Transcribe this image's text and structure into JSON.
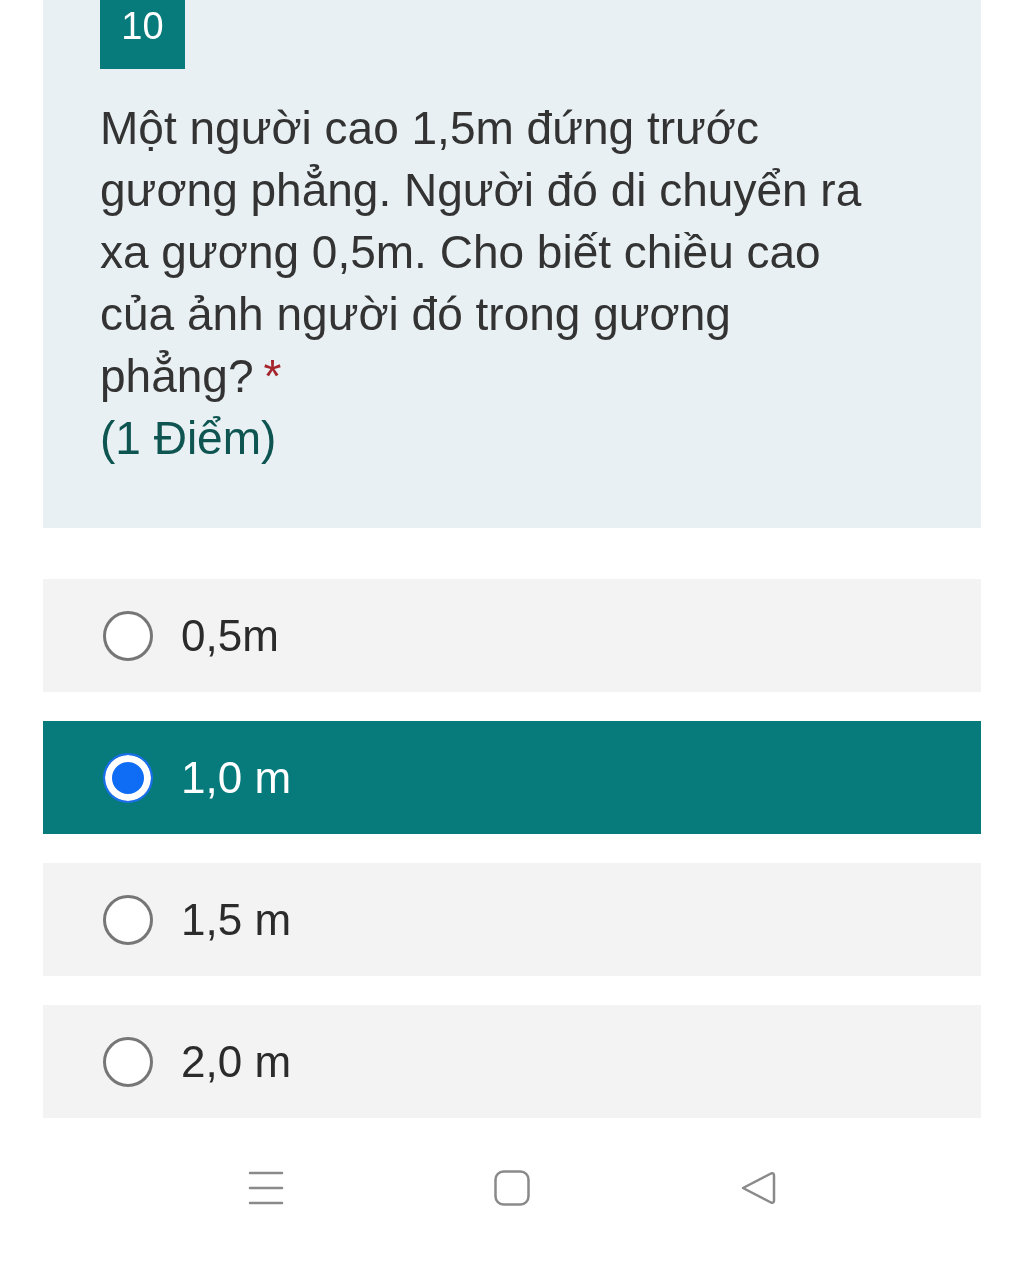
{
  "question": {
    "number": "10",
    "text": "Một người cao 1,5m đứng trước gương phẳng. Người đó di chuyển ra xa gương 0,5m. Cho biết chiều cao của ảnh người đó trong gương phẳng?",
    "required_mark": "*",
    "points": "(1 Điểm)"
  },
  "options": [
    {
      "label": "0,5m",
      "selected": false
    },
    {
      "label": "1,0 m",
      "selected": true
    },
    {
      "label": "1,5 m",
      "selected": false
    },
    {
      "label": "2,0 m",
      "selected": false
    }
  ]
}
